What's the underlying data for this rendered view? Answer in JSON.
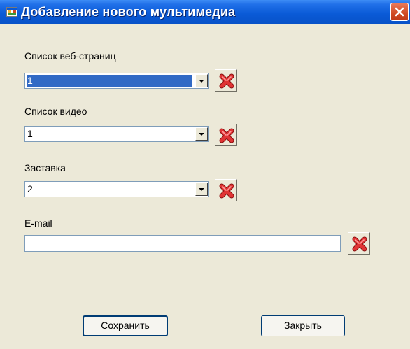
{
  "window": {
    "title": "Добавление нового мультимедиа"
  },
  "webpages": {
    "label": "Список веб-страниц",
    "value": "1"
  },
  "videos": {
    "label": "Список видео",
    "value": "1"
  },
  "screensaver": {
    "label": "Заставка",
    "value": "2"
  },
  "email": {
    "label": "E-mail",
    "value": ""
  },
  "buttons": {
    "save": "Сохранить",
    "close": "Закрыть"
  },
  "icons": {
    "app": "form-icon",
    "close": "close-icon",
    "delete": "red-x-delete-icon"
  },
  "colors": {
    "titlebar": "#0a5ad6",
    "window_bg": "#ece9d8",
    "selection": "#316ac5",
    "delete_red": "#e03434",
    "close_button": "#d04a23"
  }
}
